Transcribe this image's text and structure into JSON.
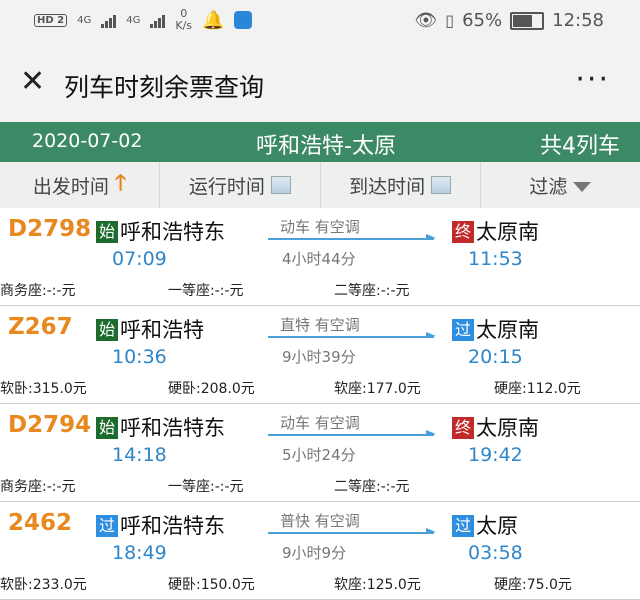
{
  "status": {
    "hd": "HD 2",
    "net1": "4G",
    "net2": "4G",
    "speed_value": "0",
    "speed_unit": "K/s",
    "battery": "65%",
    "time": "12:58"
  },
  "appbar": {
    "close_icon": "close-icon",
    "title": "列车时刻余票查询",
    "more_icon": "more-icon",
    "more": "···"
  },
  "info": {
    "date": "2020-07-02",
    "route": "呼和浩特-太原",
    "count": "共4列车"
  },
  "sort": {
    "depart": "出发时间",
    "run": "运行时间",
    "arrive": "到达时间",
    "filter": "过滤"
  },
  "trains": [
    {
      "no": "D2798",
      "from_badge": "始",
      "from": "呼和浩特东",
      "dep": "07:09",
      "type": "动车  有空调",
      "dur": "4小时44分",
      "to_badge": "终",
      "to": "太原南",
      "arr": "11:53",
      "seats": [
        "商务座:-:-元",
        "一等座:-:-元",
        "二等座:-:-元"
      ]
    },
    {
      "no": "Z267",
      "from_badge": "始",
      "from": "呼和浩特",
      "dep": "10:36",
      "type": "直特  有空调",
      "dur": "9小时39分",
      "to_badge": "过",
      "to": "太原南",
      "arr": "20:15",
      "seats": [
        "软卧:315.0元",
        "硬卧:208.0元",
        "软座:177.0元",
        "硬座:112.0元"
      ]
    },
    {
      "no": "D2794",
      "from_badge": "始",
      "from": "呼和浩特东",
      "dep": "14:18",
      "type": "动车  有空调",
      "dur": "5小时24分",
      "to_badge": "终",
      "to": "太原南",
      "arr": "19:42",
      "seats": [
        "商务座:-:-元",
        "一等座:-:-元",
        "二等座:-:-元"
      ]
    },
    {
      "no": "2462",
      "from_badge": "过",
      "from": "呼和浩特东",
      "dep": "18:49",
      "type": "普快  有空调",
      "dur": "9小时9分",
      "to_badge": "过",
      "to": "太原",
      "arr": "03:58",
      "seats": [
        "软卧:233.0元",
        "硬卧:150.0元",
        "软座:125.0元",
        "硬座:75.0元"
      ]
    }
  ],
  "colors": {
    "header_green": "#3c8a65",
    "train_no_orange": "#e8891f",
    "time_blue": "#2f86c8",
    "badge_start": "#1e6b2e",
    "badge_end": "#c22a2a",
    "badge_pass": "#2e8fe0"
  }
}
